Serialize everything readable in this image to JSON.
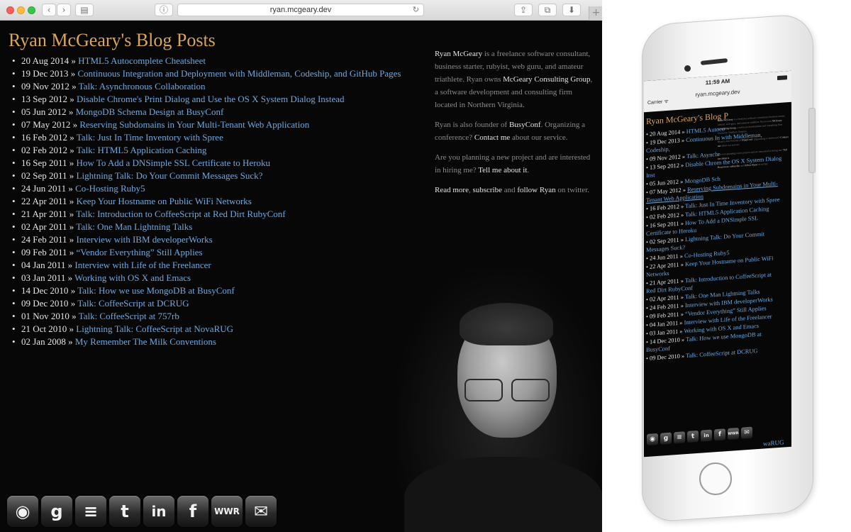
{
  "browser": {
    "url": "ryan.mcgeary.dev",
    "controls": {
      "back": "‹",
      "forward": "›",
      "sidebar": "▤",
      "reader": "ⓘ",
      "reload": "↻",
      "share": "⇪",
      "tabs": "⧉",
      "download": "⬇",
      "new_tab": "+"
    }
  },
  "page": {
    "title": "Ryan McGeary's Blog Posts",
    "separator": "»",
    "bullet": "•",
    "posts": [
      {
        "date": "20 Aug 2014",
        "title": "HTML5 Autocomplete Cheatsheet"
      },
      {
        "date": "19 Dec 2013",
        "title": "Continuous Integration and Deployment with Middleman, Codeship, and GitHub Pages"
      },
      {
        "date": "09 Nov 2012",
        "title": "Talk: Asynchronous Collaboration"
      },
      {
        "date": "13 Sep 2012",
        "title": "Disable Chrome's Print Dialog and Use the OS X System Dialog Instead"
      },
      {
        "date": "05 Jun 2012",
        "title": "MongoDB Schema Design at BusyConf"
      },
      {
        "date": "07 May 2012",
        "title": "Reserving Subdomains in Your Multi-Tenant Web Application"
      },
      {
        "date": "16 Feb 2012",
        "title": "Talk: Just In Time Inventory with Spree"
      },
      {
        "date": "02 Feb 2012",
        "title": "Talk: HTML5 Application Caching"
      },
      {
        "date": "16 Sep 2011",
        "title": "How To Add a DNSimple SSL Certificate to Heroku"
      },
      {
        "date": "02 Sep 2011",
        "title": "Lightning Talk: Do Your Commit Messages Suck?"
      },
      {
        "date": "24 Jun 2011",
        "title": "Co-Hosting Ruby5"
      },
      {
        "date": "22 Apr 2011",
        "title": "Keep Your Hostname on Public WiFi Networks"
      },
      {
        "date": "21 Apr 2011",
        "title": "Talk: Introduction to CoffeeScript at Red Dirt RubyConf"
      },
      {
        "date": "02 Apr 2011",
        "title": "Talk: One Man Lightning Talks"
      },
      {
        "date": "24 Feb 2011",
        "title": "Interview with IBM developerWorks"
      },
      {
        "date": "09 Feb 2011",
        "title": "“Vendor Everything” Still Applies"
      },
      {
        "date": "04 Jan 2011",
        "title": "Interview with Life of the Freelancer"
      },
      {
        "date": "03 Jan 2011",
        "title": "Working with OS X and Emacs"
      },
      {
        "date": "14 Dec 2010",
        "title": "Talk: How we use MongoDB at BusyConf"
      },
      {
        "date": "09 Dec 2010",
        "title": "Talk: CoffeeScript at DCRUG"
      },
      {
        "date": "01 Nov 2010",
        "title": "Talk: CoffeeScript at 757rb"
      },
      {
        "date": "21 Oct 2010",
        "title": "Lightning Talk: CoffeeScript at NovaRUG"
      },
      {
        "date": "02 Jan 2008",
        "title": "My Remember The Milk Conventions"
      }
    ],
    "sidebar": {
      "p1": [
        "Ryan McGeary",
        " is a freelance software consultant, business starter, rubyist, web guru, and amateur triathlete. Ryan owns ",
        "McGeary Consulting Group",
        ", a software development and consulting firm located in Northern Virginia."
      ],
      "p2": [
        "Ryan is also founder of ",
        "BusyConf",
        ". Organizing a conference? ",
        "Contact me",
        " about our service."
      ],
      "p3": [
        "Are you planning a new project and are interested in hiring me? ",
        "Tell me about it",
        "."
      ],
      "p4": [
        "Read more",
        ", ",
        "subscribe",
        " and ",
        "follow Ryan",
        " on twitter."
      ]
    },
    "social": [
      {
        "name": "rss",
        "glyph": "◉"
      },
      {
        "name": "google",
        "glyph": "g"
      },
      {
        "name": "stack",
        "glyph": "≡"
      },
      {
        "name": "twitter",
        "glyph": "t"
      },
      {
        "name": "linkedin",
        "glyph": "in"
      },
      {
        "name": "facebook",
        "glyph": "f"
      },
      {
        "name": "wwr",
        "glyph": "WWR"
      },
      {
        "name": "email",
        "glyph": "✉"
      }
    ]
  },
  "phone": {
    "time": "11:59 AM",
    "carrier": "Carrier ᯤ",
    "url": "ryan.mcgeary.dev",
    "title": "Ryan McGeary's Blog P",
    "posts": [
      {
        "date": "20 Aug 2014",
        "title": "HTML5 Autoco"
      },
      {
        "date": "19 Dec 2013",
        "title": "Continuous In with Middleman, Codeship,"
      },
      {
        "date": "09 Nov 2012",
        "title": "Talk: Asynchr"
      },
      {
        "date": "13 Sep 2012",
        "title": "Disable Chrom the OS X System Dialog Inst"
      },
      {
        "date": "05 Jun 2012",
        "title": "MongoDB Sch"
      },
      {
        "date": "07 May 2012",
        "title": "Reserving Subdomains in Your Multi-Tenant Web Application",
        "hover": true
      },
      {
        "date": "16 Feb 2012",
        "title": "Talk: Just In Time Inventory with Spree"
      },
      {
        "date": "02 Feb 2012",
        "title": "Talk: HTML5 Application Caching"
      },
      {
        "date": "16 Sep 2011",
        "title": "How To Add a DNSimple SSL Certificate to Heroku"
      },
      {
        "date": "02 Sep 2011",
        "title": "Lightning Talk: Do Your Commit Messages Suck?"
      },
      {
        "date": "24 Jun 2011",
        "title": "Co-Hosting Ruby5"
      },
      {
        "date": "22 Apr 2011",
        "title": "Keep Your Hostname on Public WiFi Networks"
      },
      {
        "date": "21 Apr 2011",
        "title": "Talk: Introduction to CoffeeScript at Red Dirt RubyConf"
      },
      {
        "date": "02 Apr 2011",
        "title": "Talk: One Man Lightning Talks"
      },
      {
        "date": "24 Feb 2011",
        "title": "Interview with IBM developerWorks"
      },
      {
        "date": "09 Feb 2011",
        "title": "“Vendor Everything” Still Applies"
      },
      {
        "date": "04 Jan 2011",
        "title": "Interview with Life of the Freelancer"
      },
      {
        "date": "03 Jan 2011",
        "title": "Working with OS X and Emacs"
      },
      {
        "date": "14 Dec 2010",
        "title": "Talk: How we use MongoDB at BusyConf"
      },
      {
        "date": "09 Dec 2010",
        "title": "Talk: CoffeeScript at DCRUG"
      }
    ],
    "overflow_text": "waRUG"
  }
}
